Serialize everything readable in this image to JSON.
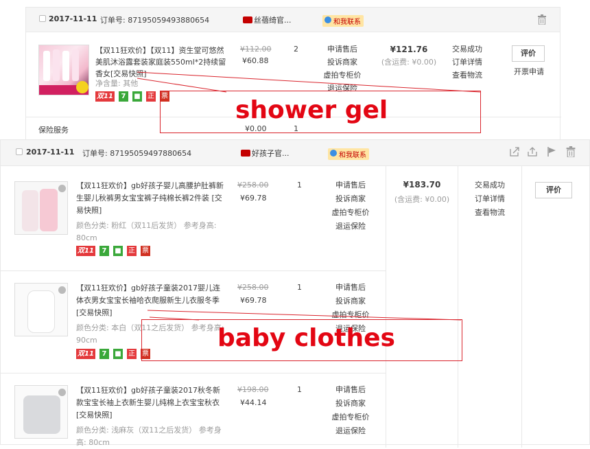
{
  "order1": {
    "date": "2017-11-11",
    "order_no": "订单号: 87195059493880654",
    "shop": "丝蓓绮官...",
    "contact": "和我联系",
    "item": {
      "title": "【双11狂欢价】【双11】资生堂可悠然美肌沐浴露套装家庭装550ml*2持续留香女[交易快照]",
      "attr": "净含量: 其他",
      "orig_price": "¥112.00",
      "price": "¥60.88",
      "qty": "2",
      "ops": [
        "申请售后",
        "投诉商家",
        "虚拍专柜价",
        "退运保险"
      ]
    },
    "total": "¥121.76",
    "shipping": "(含运费: ¥0.00)",
    "status": [
      "交易成功",
      "订单详情",
      "查看物流"
    ],
    "rate_button": "评价",
    "invoice": "开票申请",
    "service": {
      "label": "保险服务",
      "price": "¥0.00",
      "qty": "1"
    }
  },
  "order2": {
    "date": "2017-11-11",
    "order_no": "订单号: 87195059497880654",
    "shop": "好孩子官...",
    "contact": "和我联系",
    "total": "¥183.70",
    "shipping": "(含运费: ¥0.00)",
    "status": [
      "交易成功",
      "订单详情",
      "查看物流"
    ],
    "rate_button": "评价",
    "items": [
      {
        "title": "【双11狂欢价】gb好孩子婴儿高腰护肚裤新生婴儿秋裤男女宝宝裤子纯棉长裤2件装 [交易快照]",
        "attr": "颜色分类: 粉红（双11后发货） 参考身高: 80cm",
        "orig_price": "¥258.00",
        "price": "¥69.78",
        "qty": "1",
        "ops": [
          "申请售后",
          "投诉商家",
          "虚拍专柜价",
          "退运保险"
        ]
      },
      {
        "title": "【双11狂欢价】gb好孩子童装2017婴儿连体衣男女宝宝长袖哈衣爬服新生儿衣服冬季 [交易快照]",
        "attr": "颜色分类: 本白（双11之后发货） 参考身高: 90cm",
        "orig_price": "¥258.00",
        "price": "¥69.78",
        "qty": "1",
        "ops": [
          "申请售后",
          "投诉商家",
          "虚拍专柜价",
          "退运保险"
        ]
      },
      {
        "title": "【双11狂欢价】gb好孩子童装2017秋冬新款宝宝长袖上衣新生婴儿纯棉上衣宝宝秋衣 [交易快照]",
        "attr": "颜色分类: 浅麻灰（双11之后发货） 参考身高: 80cm",
        "orig_price": "¥198.00",
        "price": "¥44.14",
        "qty": "1",
        "ops": [
          "申请售后",
          "投诉商家",
          "虚拍专柜价",
          "退运保险"
        ]
      }
    ]
  },
  "badges": {
    "double11": "双11",
    "seven": "7",
    "genuine": "正",
    "receipt": "票"
  },
  "annotations": {
    "shower": "shower gel",
    "baby": "baby clothes"
  },
  "colors": {
    "accent": "#e30613",
    "tmall": "#c40000",
    "green": "#3aa83a"
  }
}
